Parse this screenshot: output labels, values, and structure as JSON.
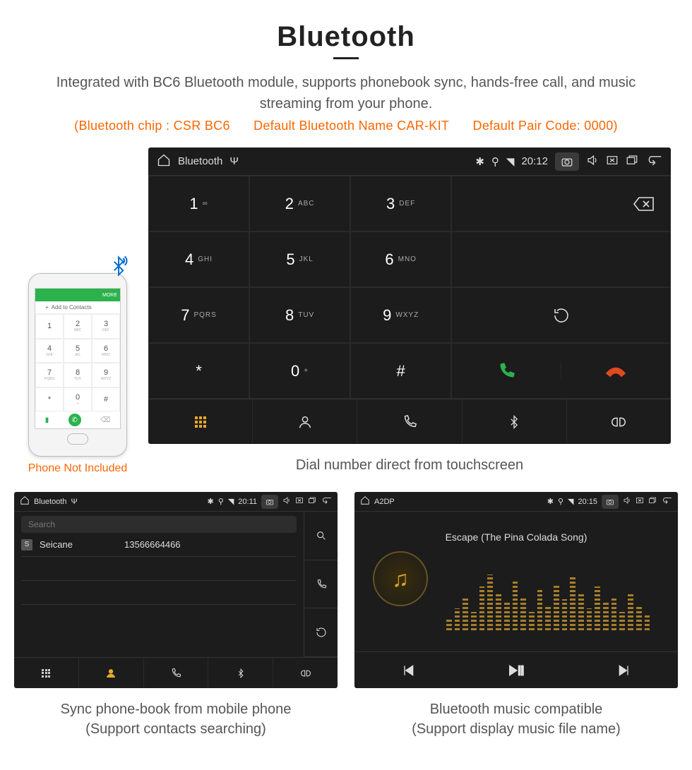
{
  "header": {
    "title": "Bluetooth",
    "description": "Integrated with BC6 Bluetooth module, supports phonebook sync, hands-free call, and music streaming from your phone.",
    "spec_chip": "(Bluetooth chip : CSR BC6",
    "spec_name": "Default Bluetooth Name CAR-KIT",
    "spec_code": "Default Pair Code: 0000)"
  },
  "phone": {
    "topbar": "MORE",
    "add_to_contacts": "Add to Contacts",
    "keys": [
      {
        "d": "1",
        "s": ""
      },
      {
        "d": "2",
        "s": "ABC"
      },
      {
        "d": "3",
        "s": "DEF"
      },
      {
        "d": "4",
        "s": "GHI"
      },
      {
        "d": "5",
        "s": "JKL"
      },
      {
        "d": "6",
        "s": "MNO"
      },
      {
        "d": "7",
        "s": "PQRS"
      },
      {
        "d": "8",
        "s": "TUV"
      },
      {
        "d": "9",
        "s": "WXYZ"
      },
      {
        "d": "*",
        "s": ""
      },
      {
        "d": "0",
        "s": "+"
      },
      {
        "d": "#",
        "s": ""
      }
    ],
    "not_included": "Phone Not Included"
  },
  "dialer": {
    "status": {
      "app": "Bluetooth",
      "time": "20:12"
    },
    "keys": [
      {
        "d": "1",
        "s": "∞"
      },
      {
        "d": "2",
        "s": "ABC"
      },
      {
        "d": "3",
        "s": "DEF"
      },
      {
        "d": "4",
        "s": "GHI"
      },
      {
        "d": "5",
        "s": "JKL"
      },
      {
        "d": "6",
        "s": "MNO"
      },
      {
        "d": "7",
        "s": "PQRS"
      },
      {
        "d": "8",
        "s": "TUV"
      },
      {
        "d": "9",
        "s": "WXYZ"
      },
      {
        "d": "*",
        "s": ""
      },
      {
        "d": "0",
        "s": "+"
      },
      {
        "d": "#",
        "s": ""
      }
    ],
    "caption": "Dial number direct from touchscreen"
  },
  "contacts": {
    "status": {
      "app": "Bluetooth",
      "time": "20:11"
    },
    "search_placeholder": "Search",
    "row_badge": "S",
    "row_name": "Seicane",
    "row_number": "13566664466",
    "caption_l1": "Sync phone-book from mobile phone",
    "caption_l2": "(Support contacts searching)"
  },
  "music": {
    "status": {
      "app": "A2DP",
      "time": "20:15"
    },
    "track": "Escape (The Pina Colada Song)",
    "caption_l1": "Bluetooth music compatible",
    "caption_l2": "(Support display music file name)"
  }
}
